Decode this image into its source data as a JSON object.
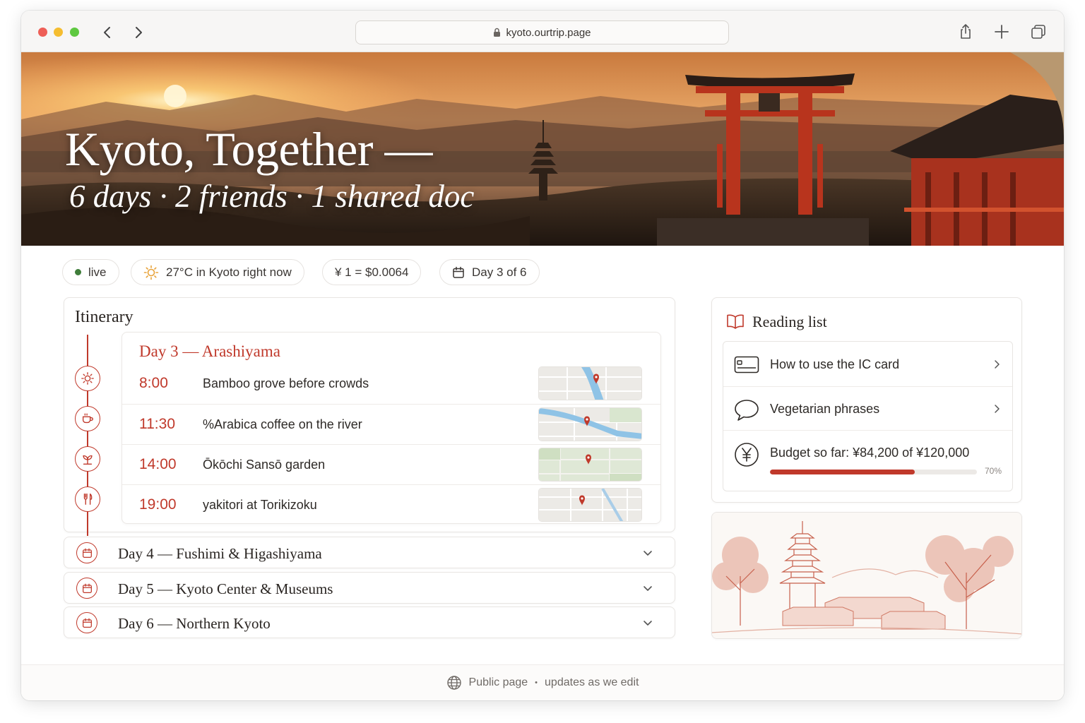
{
  "browser": {
    "url": "kyoto.ourtrip.page",
    "traffic_lights": [
      "#ee5f57",
      "#f5bd30",
      "#5ec840"
    ]
  },
  "hero": {
    "title": "Kyoto, Together —",
    "subtitle": "6 days · 2 friends · 1 shared doc"
  },
  "status": {
    "live": "live",
    "weather": "27°C in Kyoto right now",
    "currency": "¥ 1 = $0.0064",
    "day": "Day 3 of 6"
  },
  "itinerary": {
    "title": "Itinerary",
    "current_day": {
      "heading": "Day 3 — Arashiyama",
      "items": [
        {
          "time": "8:00",
          "desc": "Bamboo grove before crowds",
          "icon": "sun-icon"
        },
        {
          "time": "11:30",
          "desc": "%Arabica coffee on the river",
          "icon": "coffee-icon"
        },
        {
          "time": "14:00",
          "desc": "Ōkōchi Sansō garden",
          "icon": "plant-icon"
        },
        {
          "time": "19:00",
          "desc": "yakitori at Torikizoku",
          "icon": "utensils-icon"
        }
      ]
    },
    "days": [
      {
        "label": "Day 4 — Fushimi & Higashiyama"
      },
      {
        "label": "Day 5 — Kyoto Center & Museums"
      },
      {
        "label": "Day 6 — Northern Kyoto"
      }
    ]
  },
  "reading_list": {
    "title": "Reading list",
    "items": [
      {
        "label": "How to use the IC card",
        "icon": "card-icon"
      },
      {
        "label": "Vegetarian phrases",
        "icon": "chat-bubble-icon"
      }
    ],
    "budget": {
      "label": "Budget so far: ¥84,200 of ¥120,000",
      "percent_label": "70%",
      "progress": 0.7
    }
  },
  "footer": {
    "left": "Public page",
    "separator": "•",
    "right": "updates as we edit"
  },
  "colors": {
    "accent": "#c0392b",
    "live": "#3f7d3a",
    "sun": "#e8a33a"
  }
}
